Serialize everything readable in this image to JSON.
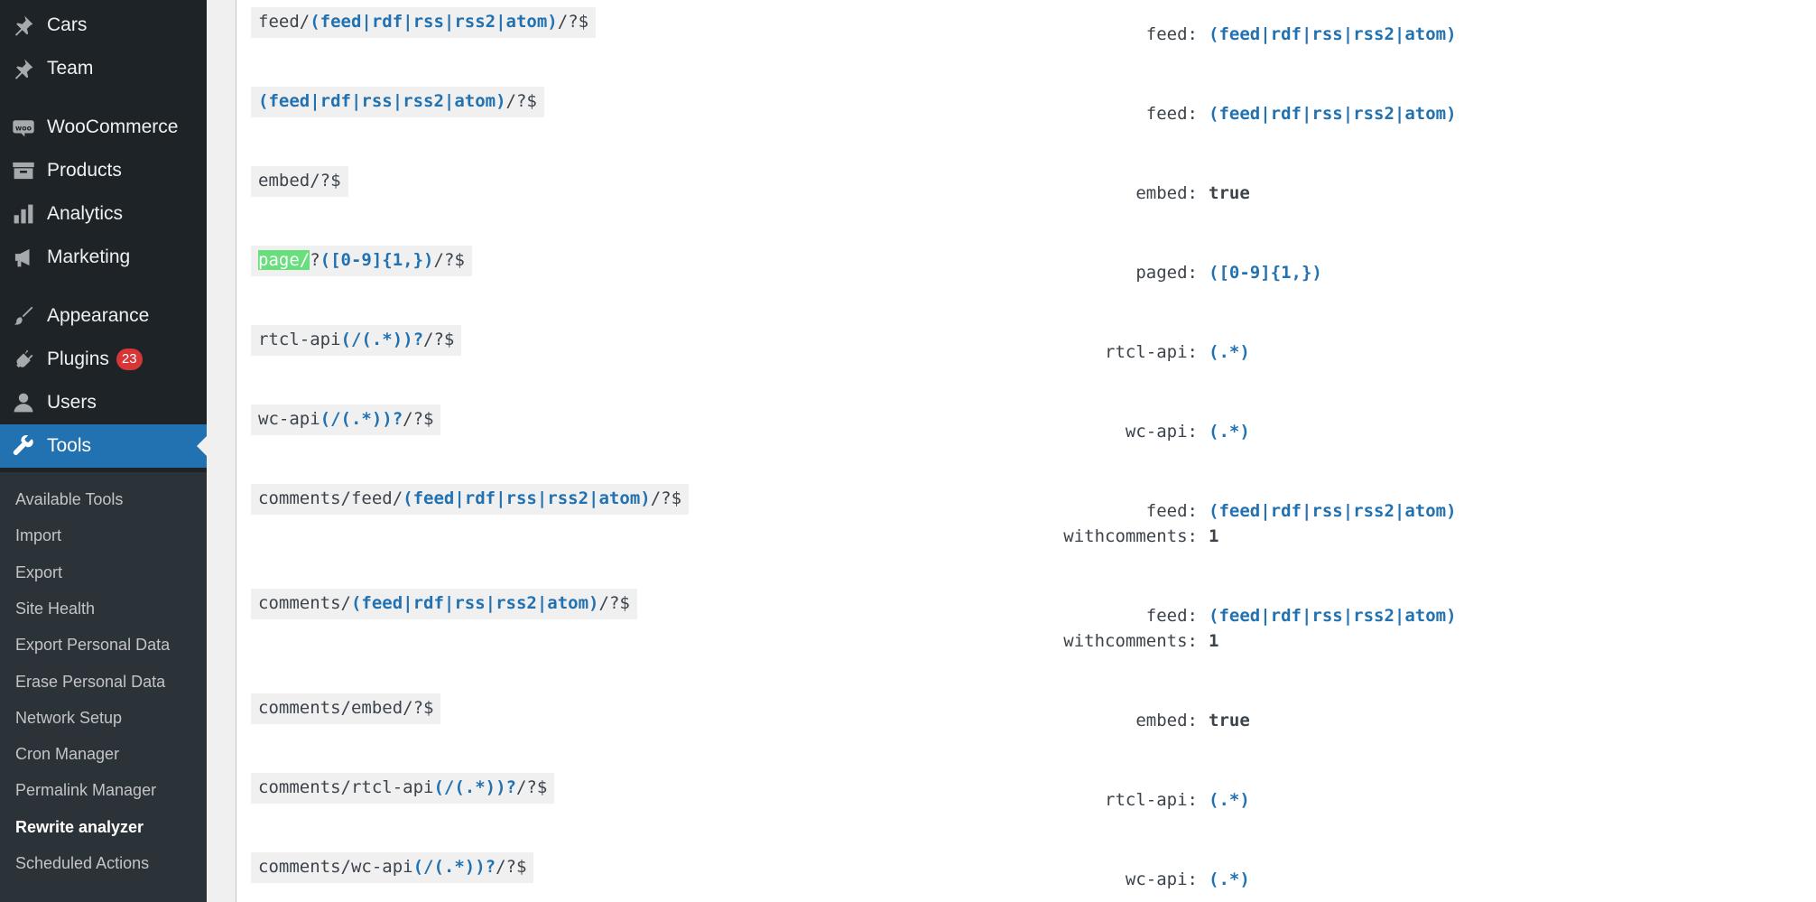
{
  "sidebar": {
    "items": [
      {
        "label": "Cars",
        "icon": "pin-icon"
      },
      {
        "label": "Team",
        "icon": "pin-icon"
      },
      {
        "label": "WooCommerce",
        "icon": "woo-icon"
      },
      {
        "label": "Products",
        "icon": "archive-icon"
      },
      {
        "label": "Analytics",
        "icon": "bar-chart-icon"
      },
      {
        "label": "Marketing",
        "icon": "megaphone-icon"
      },
      {
        "label": "Appearance",
        "icon": "paintbrush-icon"
      },
      {
        "label": "Plugins",
        "icon": "plug-icon",
        "badge": "23"
      },
      {
        "label": "Users",
        "icon": "user-icon"
      },
      {
        "label": "Tools",
        "icon": "wrench-icon",
        "active": true
      }
    ],
    "submenu": [
      "Available Tools",
      "Import",
      "Export",
      "Site Health",
      "Export Personal Data",
      "Erase Personal Data",
      "Network Setup",
      "Cron Manager",
      "Permalink Manager",
      "Rewrite analyzer",
      "Scheduled Actions"
    ],
    "current_submenu": "Rewrite analyzer",
    "accent_color": "#2271b1",
    "badge_color": "#d63638"
  },
  "rules": [
    {
      "regex": [
        [
          "t",
          "feed/"
        ],
        [
          "g",
          "(feed|rdf|rss|rss2|atom)"
        ],
        [
          "t",
          "/?$"
        ]
      ],
      "query": [
        {
          "key": "feed:",
          "value": "(feed|rdf|rss|rss2|atom)",
          "type": "group"
        }
      ]
    },
    {
      "regex": [
        [
          "g",
          "(feed|rdf|rss|rss2|atom)"
        ],
        [
          "t",
          "/?$"
        ]
      ],
      "query": [
        {
          "key": "feed:",
          "value": "(feed|rdf|rss|rss2|atom)",
          "type": "group"
        }
      ]
    },
    {
      "regex": [
        [
          "t",
          "embed/?$"
        ]
      ],
      "query": [
        {
          "key": "embed:",
          "value": "true",
          "type": "plain"
        }
      ]
    },
    {
      "regex": [
        [
          "h",
          "page/"
        ],
        [
          "t",
          "?"
        ],
        [
          "g",
          "([0-9]{1,})"
        ],
        [
          "t",
          "/?$"
        ]
      ],
      "query": [
        {
          "key": "paged:",
          "value": "([0-9]{1,})",
          "type": "group"
        }
      ]
    },
    {
      "regex": [
        [
          "t",
          "rtcl-api"
        ],
        [
          "g",
          "(/(.*))?"
        ],
        [
          "t",
          "/?$"
        ]
      ],
      "query": [
        {
          "key": "rtcl-api:",
          "value": "(.*)",
          "type": "group"
        }
      ]
    },
    {
      "regex": [
        [
          "t",
          "wc-api"
        ],
        [
          "g",
          "(/(.*))?"
        ],
        [
          "t",
          "/?$"
        ]
      ],
      "query": [
        {
          "key": "wc-api:",
          "value": "(.*)",
          "type": "group"
        }
      ]
    },
    {
      "regex": [
        [
          "t",
          "comments/feed/"
        ],
        [
          "g",
          "(feed|rdf|rss|rss2|atom)"
        ],
        [
          "t",
          "/?$"
        ]
      ],
      "query": [
        {
          "key": "feed:",
          "value": "(feed|rdf|rss|rss2|atom)",
          "type": "group"
        },
        {
          "key": "withcomments:",
          "value": "1",
          "type": "plain"
        }
      ]
    },
    {
      "regex": [
        [
          "t",
          "comments/"
        ],
        [
          "g",
          "(feed|rdf|rss|rss2|atom)"
        ],
        [
          "t",
          "/?$"
        ]
      ],
      "query": [
        {
          "key": "feed:",
          "value": "(feed|rdf|rss|rss2|atom)",
          "type": "group"
        },
        {
          "key": "withcomments:",
          "value": "1",
          "type": "plain"
        }
      ]
    },
    {
      "regex": [
        [
          "t",
          "comments/embed/?$"
        ]
      ],
      "query": [
        {
          "key": "embed:",
          "value": "true",
          "type": "plain"
        }
      ]
    },
    {
      "regex": [
        [
          "t",
          "comments/rtcl-api"
        ],
        [
          "g",
          "(/(.*))?"
        ],
        [
          "t",
          "/?$"
        ]
      ],
      "query": [
        {
          "key": "rtcl-api:",
          "value": "(.*)",
          "type": "group"
        }
      ]
    },
    {
      "regex": [
        [
          "t",
          "comments/wc-api"
        ],
        [
          "g",
          "(/(.*))?"
        ],
        [
          "t",
          "/?$"
        ]
      ],
      "query": [
        {
          "key": "wc-api:",
          "value": "(.*)",
          "type": "group"
        }
      ]
    }
  ]
}
